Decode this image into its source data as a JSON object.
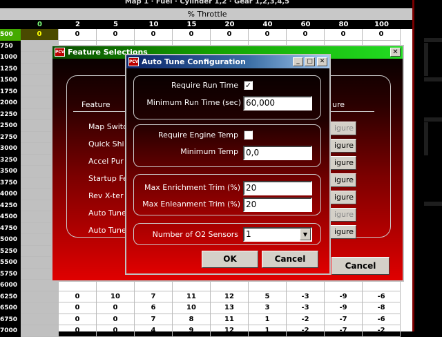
{
  "header": {
    "top_text": "Map 1 · Fuel · Cylinder 1,2 · Gear 1,2,3,4,5",
    "throttle_label": "% Throttle"
  },
  "columns": [
    "0",
    "2",
    "5",
    "10",
    "15",
    "20",
    "40",
    "60",
    "80",
    "100"
  ],
  "rows": [
    "500",
    "750",
    "1000",
    "1250",
    "1500",
    "1750",
    "2000",
    "2250",
    "2500",
    "2750",
    "3000",
    "3250",
    "3500",
    "3750",
    "4000",
    "4250",
    "4500",
    "4750",
    "5000",
    "5250",
    "5500",
    "5750",
    "6000",
    "6250",
    "6500",
    "6750",
    "7000"
  ],
  "row_values": {
    "500": [
      "0",
      "0",
      "0",
      "0",
      "0",
      "0",
      "0",
      "0",
      "0",
      "0"
    ],
    "6250": [
      "0",
      "10",
      "7",
      "11",
      "12",
      "5",
      "-3",
      "-9",
      "-6"
    ],
    "6500": [
      "0",
      "0",
      "6",
      "10",
      "13",
      "3",
      "-3",
      "-9",
      "-8"
    ],
    "6750": [
      "0",
      "0",
      "7",
      "8",
      "11",
      "1",
      "-2",
      "-7",
      "-6"
    ],
    "7000": [
      "0",
      "0",
      "4",
      "9",
      "12",
      "1",
      "-2",
      "-7",
      "-2"
    ]
  },
  "feature_window": {
    "title": "Feature Selections",
    "close": "✕",
    "col_feature": "Feature",
    "col_configure": "ure",
    "items": [
      "Map Switc",
      "Quick Shi",
      "Accel Pur",
      "Startup Fe",
      "Rev X-ter",
      "Auto Tune",
      "Auto Tune"
    ],
    "configure_label": "igure",
    "cancel": "Cancel"
  },
  "autotune_dialog": {
    "title": "Auto Tune Configuration",
    "icon_text": "PCV",
    "require_run_time_label": "Require Run Time",
    "require_run_time_checked": "✓",
    "min_run_time_label": "Minimum Run Time (sec)",
    "min_run_time_value": "60,000",
    "require_engine_temp_label": "Require Engine Temp",
    "require_engine_temp_checked": "",
    "min_temp_label": "Minimum Temp",
    "min_temp_value": "0,0",
    "max_enrich_label": "Max Enrichment Trim (%)",
    "max_enrich_value": "20",
    "max_enlean_label": "Max Enleanment Trim (%)",
    "max_enlean_value": "20",
    "o2_label": "Number of O2 Sensors",
    "o2_value": "1",
    "ok": "OK",
    "cancel": "Cancel",
    "minimize": "_",
    "maximize": "□",
    "close": "✕"
  }
}
